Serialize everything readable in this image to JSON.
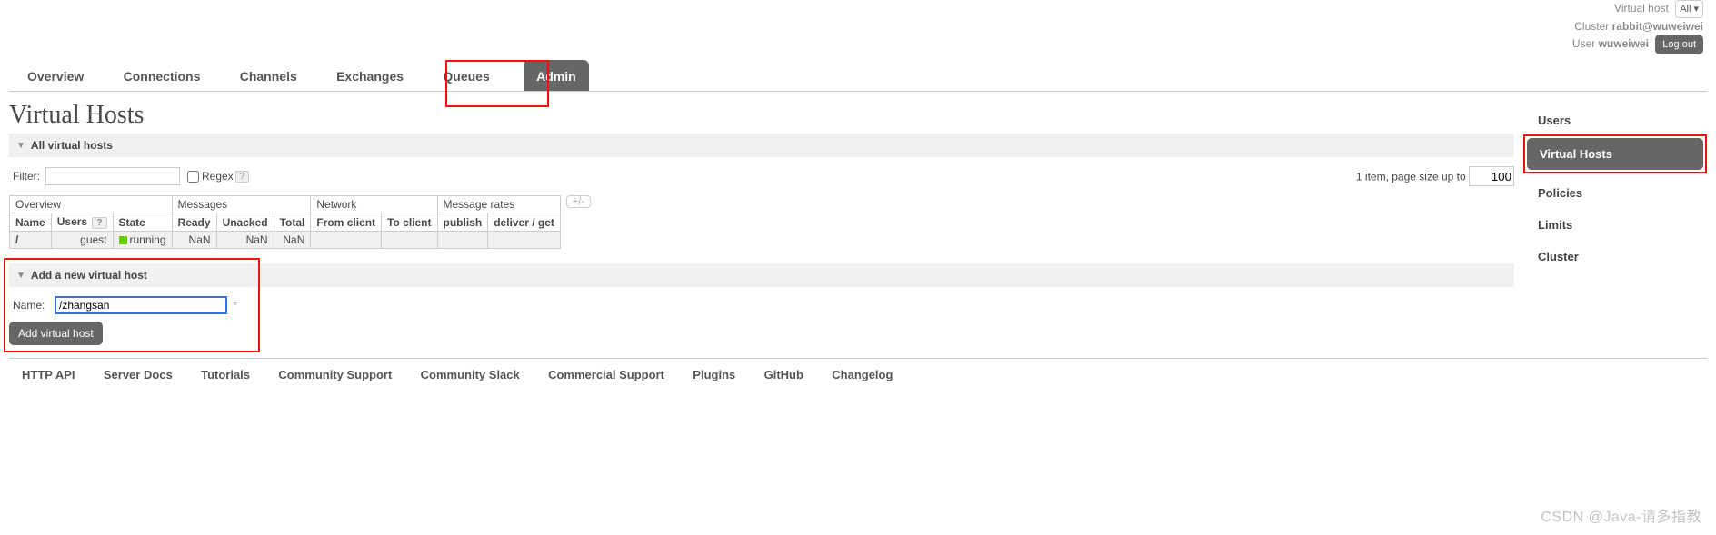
{
  "header": {
    "vhost_label": "Virtual host",
    "vhost_value": "All",
    "cluster_label": "Cluster",
    "cluster_value": "rabbit@wuweiwei",
    "user_label": "User",
    "user_value": "wuweiwei",
    "logout": "Log out"
  },
  "tabs": [
    "Overview",
    "Connections",
    "Channels",
    "Exchanges",
    "Queues",
    "Admin"
  ],
  "selected_tab": "Admin",
  "page_title": "Virtual Hosts",
  "sections": {
    "all_vhosts": "All virtual hosts",
    "add_vhost": "Add a new virtual host"
  },
  "filter": {
    "label": "Filter:",
    "value": "",
    "regex_label": "Regex",
    "help": "?"
  },
  "pagesize": {
    "text": "1 item, page size up to",
    "value": "100"
  },
  "table": {
    "group_headers": [
      "Overview",
      "Messages",
      "Network",
      "Message rates"
    ],
    "sub_headers": {
      "overview": [
        "Name",
        "Users",
        "State"
      ],
      "users_help": "?",
      "messages": [
        "Ready",
        "Unacked",
        "Total"
      ],
      "network": [
        "From client",
        "To client"
      ],
      "rates": [
        "publish",
        "deliver / get"
      ]
    },
    "rows": [
      {
        "name": "/",
        "users": "guest",
        "state": "running",
        "ready": "NaN",
        "unacked": "NaN",
        "total": "NaN",
        "from_client": "",
        "to_client": "",
        "publish": "",
        "deliver_get": ""
      }
    ],
    "plusminus": "+/-"
  },
  "add_form": {
    "name_label": "Name:",
    "name_value": "/zhangsan",
    "button": "Add virtual host"
  },
  "side_nav": [
    "Users",
    "Virtual Hosts",
    "Policies",
    "Limits",
    "Cluster"
  ],
  "side_selected": "Virtual Hosts",
  "footer_links": [
    "HTTP API",
    "Server Docs",
    "Tutorials",
    "Community Support",
    "Community Slack",
    "Commercial Support",
    "Plugins",
    "GitHub",
    "Changelog"
  ],
  "watermark": "CSDN @Java-请多指教"
}
